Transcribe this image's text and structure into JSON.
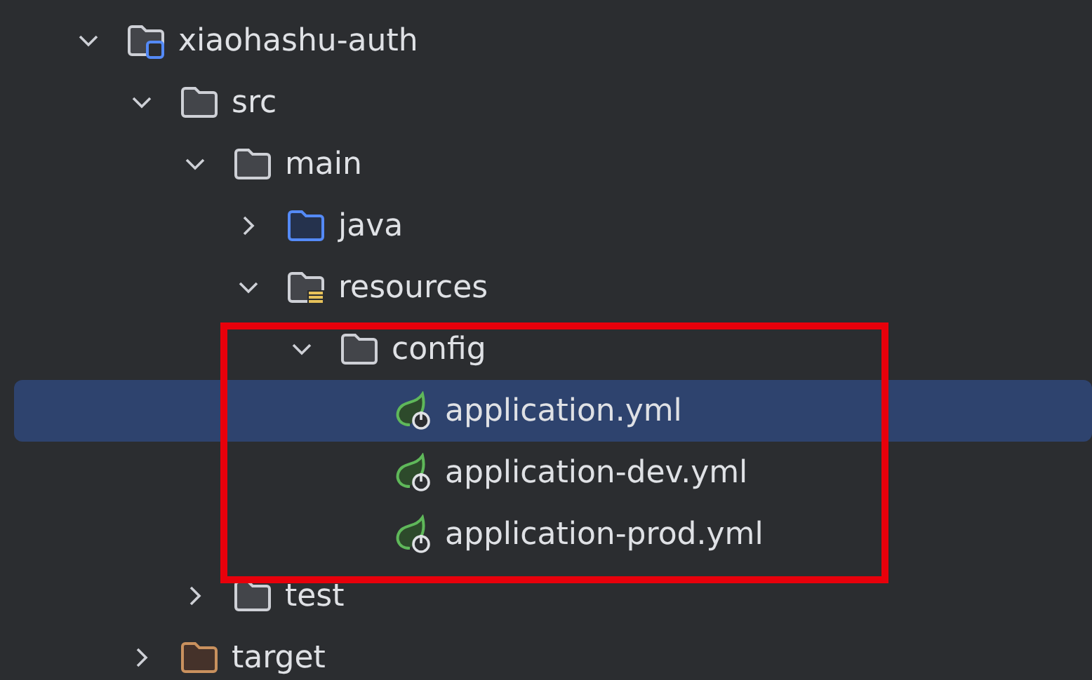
{
  "tree": [
    {
      "label": "xiaohashu-auth",
      "kind": "module",
      "expanded": true,
      "selected": false,
      "children": [
        {
          "label": "src",
          "kind": "folder",
          "expanded": true,
          "selected": false,
          "children": [
            {
              "label": "main",
              "kind": "folder",
              "expanded": true,
              "selected": false,
              "children": [
                {
                  "label": "java",
                  "kind": "source",
                  "expanded": false,
                  "selected": false
                },
                {
                  "label": "resources",
                  "kind": "resources",
                  "expanded": true,
                  "selected": false,
                  "children": [
                    {
                      "label": "config",
                      "kind": "folder",
                      "expanded": true,
                      "selected": false,
                      "framed": true,
                      "children": [
                        {
                          "label": "application.yml",
                          "kind": "spring",
                          "selected": true
                        },
                        {
                          "label": "application-dev.yml",
                          "kind": "spring",
                          "selected": false
                        },
                        {
                          "label": "application-prod.yml",
                          "kind": "spring",
                          "selected": false
                        }
                      ]
                    }
                  ]
                }
              ]
            },
            {
              "label": "test",
              "kind": "folder",
              "expanded": false,
              "selected": false
            }
          ]
        },
        {
          "label": "target",
          "kind": "excluded",
          "expanded": false,
          "selected": false
        }
      ]
    }
  ]
}
